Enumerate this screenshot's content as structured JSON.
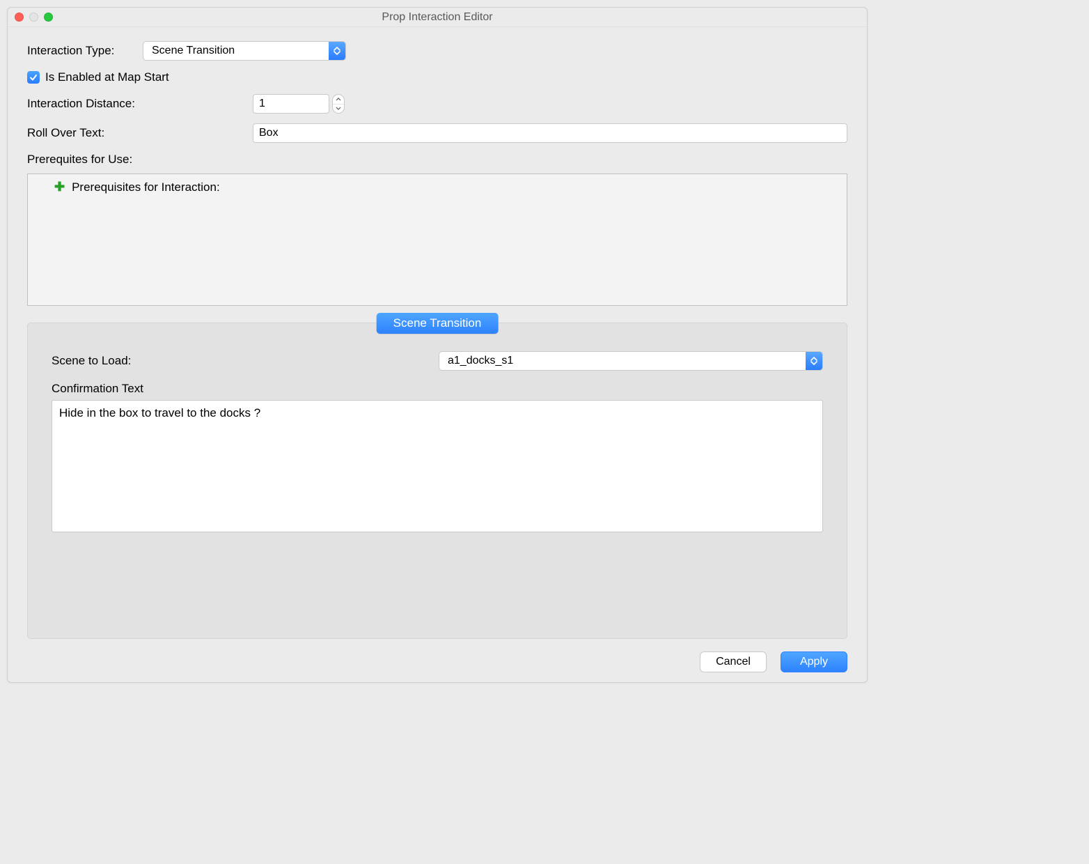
{
  "window": {
    "title": "Prop Interaction Editor"
  },
  "form": {
    "interaction_type_label": "Interaction Type:",
    "interaction_type_value": "Scene Transition",
    "enabled_label": "Is Enabled at Map Start",
    "enabled_checked": true,
    "distance_label": "Interaction Distance:",
    "distance_value": "1",
    "rollover_label": "Roll Over Text:",
    "rollover_value": "Box",
    "prereq_section_label": "Prerequites for Use:",
    "prereq_header": "Prerequisites for Interaction:"
  },
  "scene_panel": {
    "title": "Scene Transition",
    "scene_label": "Scene to Load:",
    "scene_value": "a1_docks_s1",
    "confirm_label": "Confirmation Text",
    "confirm_value": "Hide in the box to travel to the docks ?"
  },
  "footer": {
    "cancel": "Cancel",
    "apply": "Apply"
  }
}
